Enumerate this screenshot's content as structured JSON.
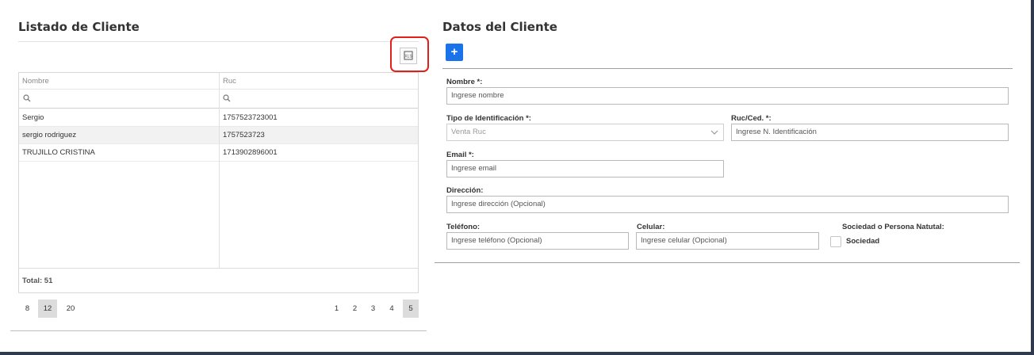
{
  "left_panel": {
    "title": "Listado de Cliente",
    "export_icon": "excel-export-icon",
    "columns": [
      "Nombre",
      "Ruc"
    ],
    "rows": [
      {
        "nombre": "Sergio",
        "ruc": "1757523723001"
      },
      {
        "nombre": "sergio rodriguez",
        "ruc": "1757523723"
      },
      {
        "nombre": "TRUJILLO CRISTINA",
        "ruc": "1713902896001"
      }
    ],
    "total": "Total: 51",
    "page_sizes": [
      "8",
      "12",
      "20"
    ],
    "selected_page_size": "12",
    "pages": [
      "1",
      "2",
      "3",
      "4",
      "5"
    ],
    "current_page": "5"
  },
  "right_panel": {
    "title": "Datos del Cliente",
    "add_button": "+",
    "fields": {
      "nombre": {
        "label": "Nombre *:",
        "placeholder": "Ingrese nombre"
      },
      "tipo_id": {
        "label": "Tipo de Identificación *:",
        "value": "Venta Ruc"
      },
      "ruc": {
        "label": "Ruc/Ced. *:",
        "placeholder": "Ingrese N. Identificación"
      },
      "email": {
        "label": "Email *:",
        "placeholder": "Ingrese email"
      },
      "direccion": {
        "label": "Dirección:",
        "placeholder": "Ingrese dirección (Opcional)"
      },
      "telefono": {
        "label": "Teléfono:",
        "placeholder": "Ingrese teléfono (Opcional)"
      },
      "celular": {
        "label": "Celular:",
        "placeholder": "Ingrese celular (Opcional)"
      },
      "sociedad": {
        "label": "Sociedad o Persona Natutal:",
        "checkbox_label": "Sociedad"
      }
    }
  },
  "colors": {
    "accent": "#1a73e8",
    "highlight": "#e0201b",
    "frame": "#2f3b4c"
  }
}
